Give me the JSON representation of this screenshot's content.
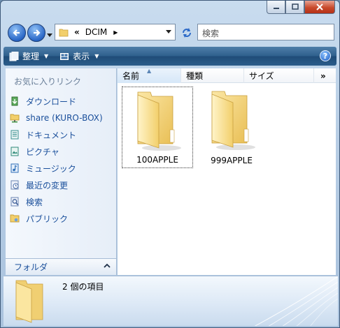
{
  "address": {
    "crumbs": [
      "«",
      "DCIM"
    ]
  },
  "search": {
    "placeholder": "検索"
  },
  "toolbar": {
    "organize": "整理",
    "view": "表示",
    "help": "?"
  },
  "sidebar": {
    "header": "お気に入りリンク",
    "items": [
      {
        "label": "ダウンロード",
        "icon": "downloads-icon",
        "color": "#3a8f3a"
      },
      {
        "label": "share (KURO-BOX)",
        "icon": "network-folder-icon",
        "color": "#d9b43b"
      },
      {
        "label": "ドキュメント",
        "icon": "documents-icon",
        "color": "#3a8f8f"
      },
      {
        "label": "ピクチャ",
        "icon": "pictures-icon",
        "color": "#2f8a7a"
      },
      {
        "label": "ミュージック",
        "icon": "music-icon",
        "color": "#2f6fb8"
      },
      {
        "label": "最近の変更",
        "icon": "recent-changes-icon",
        "color": "#6b86b3"
      },
      {
        "label": "検索",
        "icon": "search-icon",
        "color": "#4a6ea8"
      },
      {
        "label": "パブリック",
        "icon": "public-folder-icon",
        "color": "#e0b540"
      }
    ],
    "folders_label": "フォルダ"
  },
  "columns": [
    "名前",
    "種類",
    "サイズ",
    "»"
  ],
  "files": [
    {
      "name": "100APPLE",
      "selected": true
    },
    {
      "name": "999APPLE",
      "selected": false
    }
  ],
  "details": {
    "count_text": "2 個の項目"
  },
  "colors": {
    "folder": "#f4d77e",
    "toolbar": "#2b5d8a",
    "link": "#1a4f9b"
  }
}
